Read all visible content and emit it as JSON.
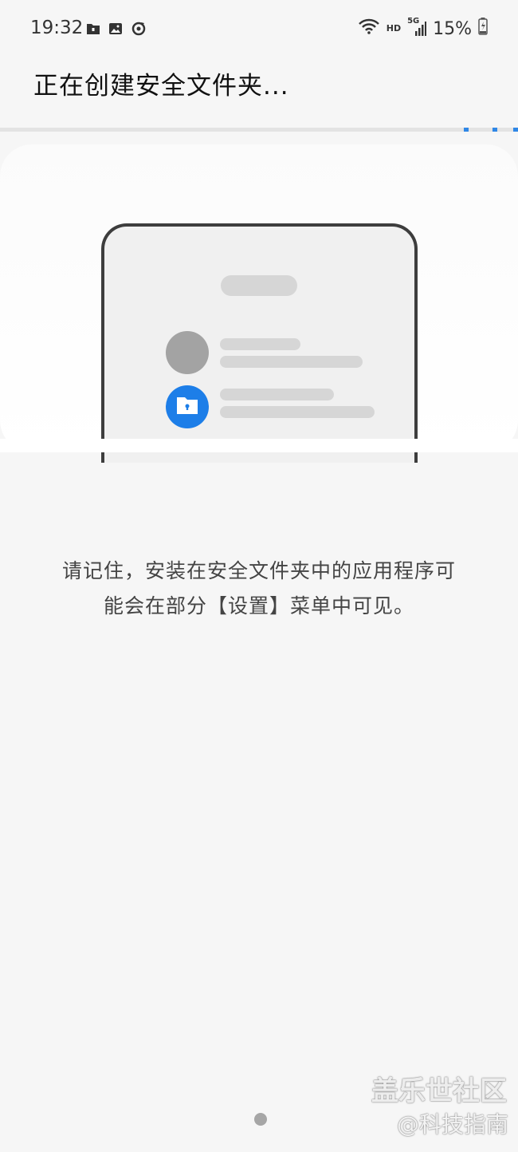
{
  "status_bar": {
    "time": "19:32",
    "network": "HD",
    "signal": "5G",
    "battery": "15%",
    "icons": [
      "secure-folder-icon",
      "image-icon",
      "sync-icon",
      "wifi-icon",
      "signal-icon",
      "battery-charging-icon"
    ]
  },
  "header": {
    "title": "正在创建安全文件夹..."
  },
  "illustration": {
    "folder_icon": "lock-folder-icon",
    "accent_color": "#1d7ee8"
  },
  "message": {
    "line1": "请记住，安装在安全文件夹中的应用程序可",
    "line2": "能会在部分【设置】菜单中可见。"
  },
  "watermark": {
    "line1": "盖乐世社区",
    "line2": "@科技指南"
  }
}
